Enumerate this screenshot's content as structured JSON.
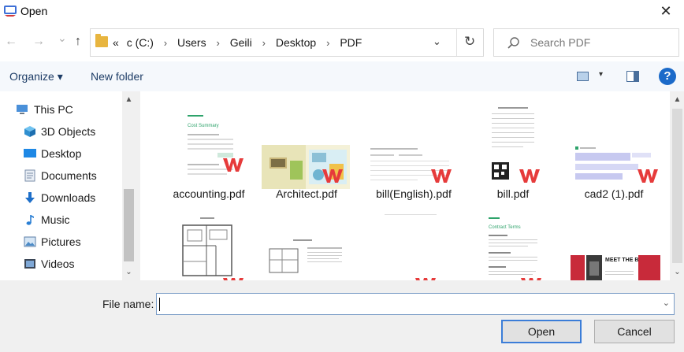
{
  "window": {
    "title": "Open",
    "close_glyph": "✕"
  },
  "nav": {
    "back": "←",
    "forward": "→",
    "history": "⌄",
    "up": "↑",
    "breadcrumbs": [
      "c (C:)",
      "Users",
      "Geili",
      "Desktop",
      "PDF"
    ],
    "overflow": "«",
    "separator": "›",
    "refresh": "↻",
    "dropdown": "⌄",
    "search_placeholder": "Search PDF"
  },
  "toolbar": {
    "organize": "Organize ▾",
    "new_folder": "New folder",
    "view_drop": "▾",
    "help": "?"
  },
  "sidebar": {
    "items": [
      {
        "label": "This PC",
        "icon": "pc-icon"
      },
      {
        "label": "3D Objects",
        "icon": "cube-icon"
      },
      {
        "label": "Desktop",
        "icon": "desktop-icon"
      },
      {
        "label": "Documents",
        "icon": "documents-icon"
      },
      {
        "label": "Downloads",
        "icon": "download-icon"
      },
      {
        "label": "Music",
        "icon": "music-icon"
      },
      {
        "label": "Pictures",
        "icon": "pictures-icon"
      },
      {
        "label": "Videos",
        "icon": "videos-icon"
      }
    ],
    "scroll_up": "▲",
    "scroll_down": "⌄"
  },
  "files": {
    "row1": [
      "accounting.pdf",
      "Architect.pdf",
      "bill(English).pdf",
      "bill.pdf",
      "cad2 (1).pdf"
    ],
    "thumb_texts": {
      "cost_summary": "Cost Summary",
      "contract_terms": "Contract Terms",
      "meet_the_boxers": "MEET THE BOXERS"
    },
    "scroll_up": "▲",
    "scroll_down": "⌄"
  },
  "bottom": {
    "file_name_label": "File name:",
    "file_name_value": "",
    "drop": "⌄",
    "open": "Open",
    "cancel": "Cancel"
  },
  "colors": {
    "accent": "#1b6ac9",
    "wps_red": "#e63b3b",
    "folder": "#e8b53f",
    "thumb_green": "#2ea36b"
  }
}
